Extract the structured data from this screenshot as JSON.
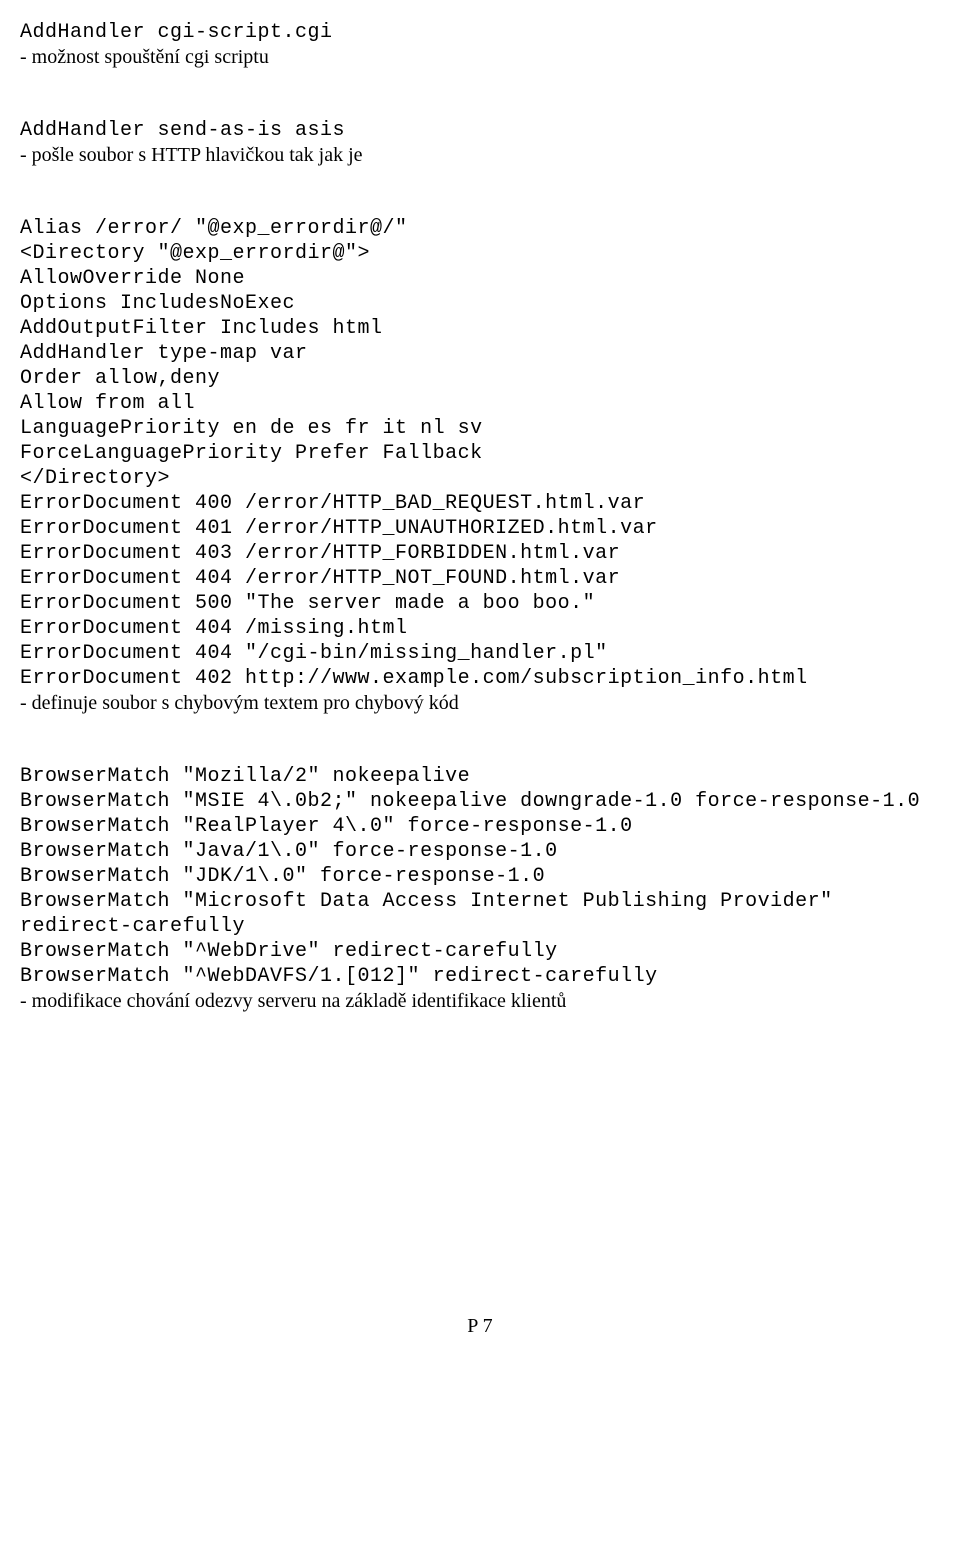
{
  "section1": {
    "l1": "AddHandler cgi-script.cgi",
    "l2": "- možnost spouštění cgi scriptu"
  },
  "section2": {
    "l1": "AddHandler send-as-is asis",
    "l2": "- pošle soubor s HTTP hlavičkou tak jak je"
  },
  "section3": {
    "l1": "Alias /error/ \"@exp_errordir@/\"",
    "l2": "<Directory \"@exp_errordir@\">",
    "l3": "AllowOverride None",
    "l4": "Options IncludesNoExec",
    "l5": "AddOutputFilter Includes html",
    "l6": "AddHandler type-map var",
    "l7": "Order allow,deny",
    "l8": "Allow from all",
    "l9": "LanguagePriority en de es fr it nl sv",
    "l10": "ForceLanguagePriority Prefer Fallback",
    "l11": "</Directory>",
    "l12": "ErrorDocument 400 /error/HTTP_BAD_REQUEST.html.var",
    "l13": "ErrorDocument 401 /error/HTTP_UNAUTHORIZED.html.var",
    "l14": "ErrorDocument 403 /error/HTTP_FORBIDDEN.html.var",
    "l15": "ErrorDocument 404 /error/HTTP_NOT_FOUND.html.var",
    "l16": "ErrorDocument 500 \"The server made a boo boo.\"",
    "l17": "ErrorDocument 404 /missing.html",
    "l18": "ErrorDocument 404 \"/cgi-bin/missing_handler.pl\"",
    "l19": "ErrorDocument 402 http://www.example.com/subscription_info.html",
    "l20": "- definuje soubor s chybovým textem pro chybový kód"
  },
  "section4": {
    "l1": "BrowserMatch \"Mozilla/2\" nokeepalive",
    "l2": "BrowserMatch \"MSIE 4\\.0b2;\" nokeepalive downgrade-1.0 force-response-1.0",
    "l3": "BrowserMatch \"RealPlayer 4\\.0\" force-response-1.0",
    "l4": "BrowserMatch \"Java/1\\.0\" force-response-1.0",
    "l5": "BrowserMatch \"JDK/1\\.0\" force-response-1.0",
    "l6": "BrowserMatch \"Microsoft Data Access Internet Publishing Provider\" redirect-carefully",
    "l7": "BrowserMatch \"^WebDrive\" redirect-carefully",
    "l8": "BrowserMatch \"^WebDAVFS/1.[012]\" redirect-carefully",
    "l9": "- modifikace chování odezvy serveru na základě identifikace klientů"
  },
  "footer": "P 7"
}
